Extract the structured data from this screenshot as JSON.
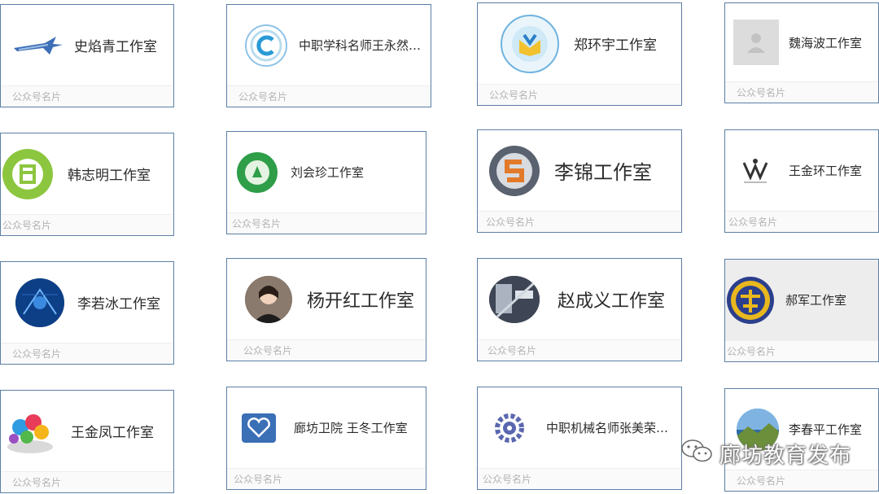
{
  "footer_label": "公众号名片",
  "cards": [
    {
      "name": "史焰青工作室",
      "icon": "airplane-icon"
    },
    {
      "name": "中职学科名师王永然…",
      "icon": "c-emblem-icon"
    },
    {
      "name": "郑环宇工作室",
      "icon": "book-emblem-icon"
    },
    {
      "name": "魏海波工作室",
      "icon": "default-avatar-icon"
    },
    {
      "name": "韩志明工作室",
      "icon": "green-building-icon"
    },
    {
      "name": "刘会珍工作室",
      "icon": "green-seal-icon"
    },
    {
      "name": "李锦工作室",
      "icon": "s-logo-icon"
    },
    {
      "name": "王金环工作室",
      "icon": "crown-logo-icon"
    },
    {
      "name": "李若冰工作室",
      "icon": "blue-tech-icon"
    },
    {
      "name": "杨开红工作室",
      "icon": "portrait-photo"
    },
    {
      "name": "赵成义工作室",
      "icon": "machine-photo"
    },
    {
      "name": "郝军工作室",
      "icon": "railway-emblem-icon"
    },
    {
      "name": "王金凤工作室",
      "icon": "colorful-circles-icon"
    },
    {
      "name": "廊坊卫院 王冬工作室",
      "icon": "heart-hands-icon"
    },
    {
      "name": "中职机械名师张美荣…",
      "icon": "gear-emblem-icon"
    },
    {
      "name": "李春平工作室",
      "icon": "landscape-photo"
    }
  ],
  "watermark": {
    "text": "廊坊教育发布",
    "icon": "wechat-icon"
  }
}
